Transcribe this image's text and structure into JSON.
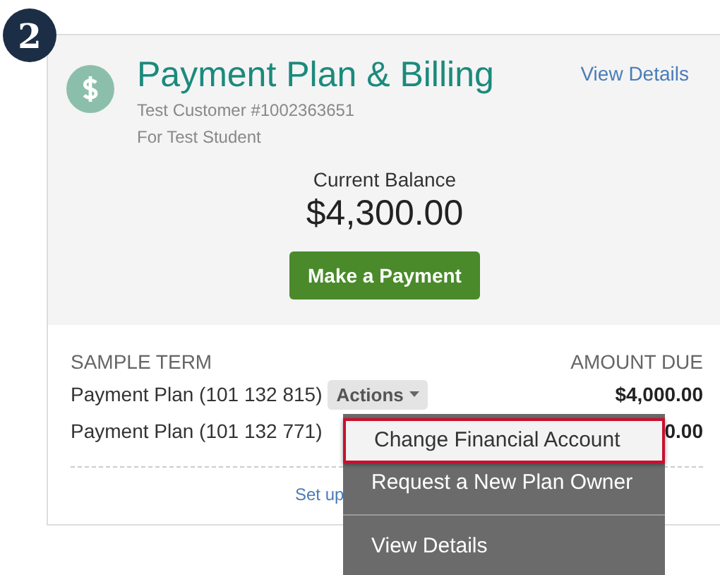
{
  "step_badge": "2",
  "header": {
    "title": "Payment Plan & Billing",
    "link": "View Details",
    "customer": "Test Customer #1002363651",
    "student": "For Test Student"
  },
  "balance": {
    "label": "Current Balance",
    "amount": "$4,300.00",
    "button": "Make a Payment"
  },
  "table": {
    "columns": [
      "SAMPLE TERM",
      "AMOUNT DUE"
    ],
    "rows": [
      {
        "plan": "Payment Plan (101 132 815)",
        "actions": "Actions",
        "amount": "$4,000.00"
      },
      {
        "plan": "Payment Plan (101 132 771)",
        "amount": "0.00"
      }
    ]
  },
  "footer_link": "Set up",
  "menu": {
    "items": [
      {
        "label": "Change Financial Account",
        "selected": true
      },
      {
        "label": "Request a New Plan Owner",
        "selected": false
      },
      {
        "label": "View Details",
        "selected": false,
        "divider_before": true
      }
    ]
  }
}
